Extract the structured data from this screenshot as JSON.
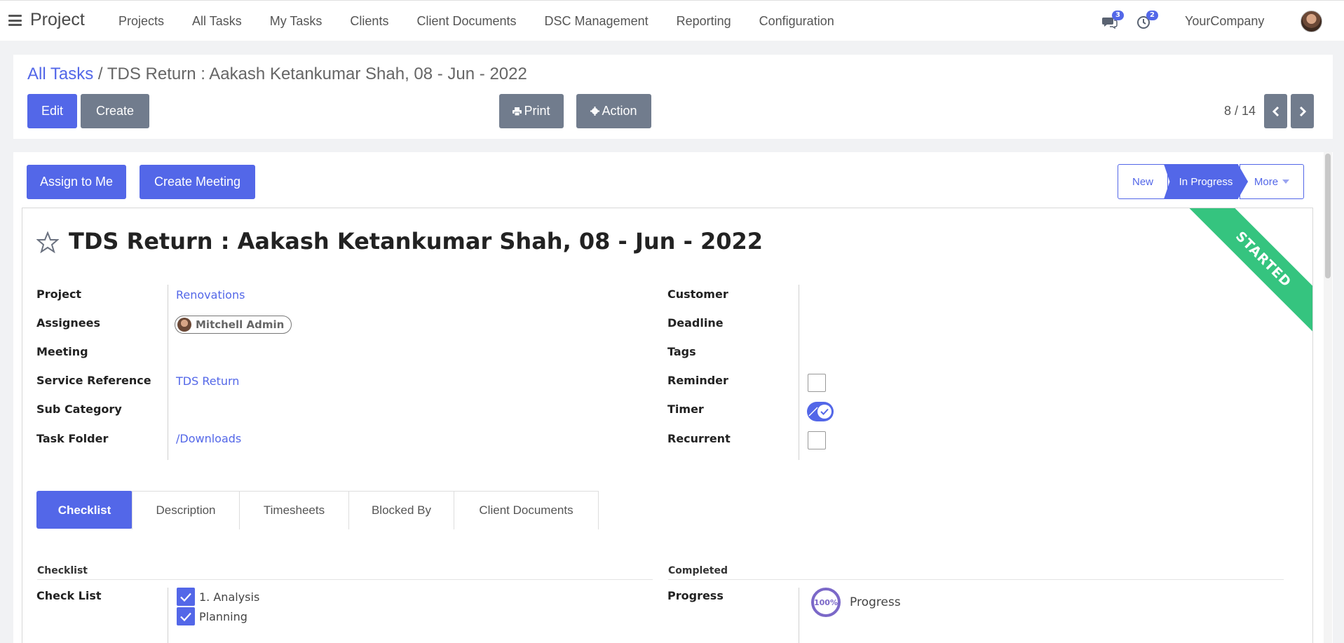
{
  "app": {
    "title": "Project"
  },
  "nav": {
    "items": [
      "Projects",
      "All Tasks",
      "My Tasks",
      "Clients",
      "Client Documents",
      "DSC Management",
      "Reporting",
      "Configuration"
    ],
    "messages_count": "3",
    "activities_count": "2",
    "company": "YourCompany"
  },
  "breadcrumb": {
    "parent": "All Tasks",
    "separator": " / ",
    "current": "TDS Return : Aakash Ketankumar Shah, 08 - Jun - 2022"
  },
  "toolbar": {
    "edit_label": "Edit",
    "create_label": "Create",
    "print_label": "Print",
    "action_label": "Action",
    "pager": "8 / 14"
  },
  "header_buttons": {
    "assign_label": "Assign to Me",
    "meeting_label": "Create Meeting"
  },
  "stages": {
    "new": "New",
    "in_progress": "In Progress",
    "more": "More",
    "active": "In Progress"
  },
  "ribbon": {
    "text": "STARTED",
    "color": "#35c47f"
  },
  "record": {
    "title": "TDS Return : Aakash Ketankumar Shah, 08 - Jun - 2022"
  },
  "fields_left": {
    "project_label": "Project",
    "project_value": "Renovations",
    "assignees_label": "Assignees",
    "assignee_name": "Mitchell Admin",
    "meeting_label": "Meeting",
    "service_reference_label": "Service Reference",
    "service_reference_value": "TDS Return",
    "sub_category_label": "Sub Category",
    "task_folder_label": "Task Folder",
    "task_folder_value": "/Downloads"
  },
  "fields_right": {
    "customer_label": "Customer",
    "deadline_label": "Deadline",
    "tags_label": "Tags",
    "reminder_label": "Reminder",
    "reminder_checked": false,
    "timer_label": "Timer",
    "timer_on": true,
    "recurrent_label": "Recurrent",
    "recurrent_checked": false
  },
  "tabs": [
    "Checklist",
    "Description",
    "Timesheets",
    "Blocked By",
    "Client Documents"
  ],
  "checklist_section": {
    "left_title": "Checklist",
    "right_title": "Completed",
    "check_list_label": "Check List",
    "items": [
      {
        "label": "1. Analysis",
        "checked": true
      },
      {
        "label": "Planning",
        "checked": true
      }
    ],
    "progress_label": "Progress",
    "progress_percent_text": "100%",
    "progress_value": 100,
    "progress_caption": "Progress"
  },
  "colors": {
    "primary": "#5367e8",
    "secondary": "#717c8d",
    "ribbon": "#35c47f"
  }
}
